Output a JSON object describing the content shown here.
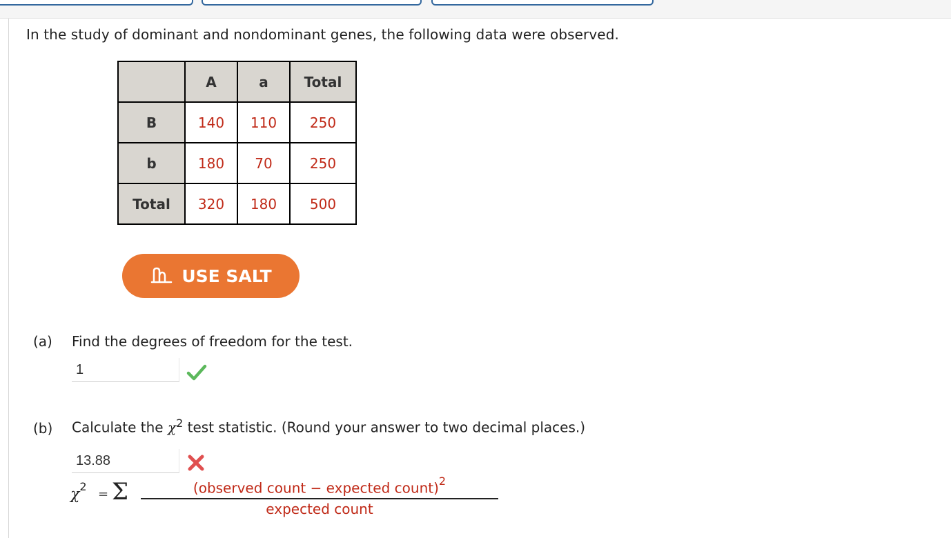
{
  "intro": "In the study of dominant and nondominant genes, the following data were observed.",
  "table": {
    "header": [
      "",
      "A",
      "a",
      "Total"
    ],
    "rows": [
      {
        "label": "B",
        "values": [
          "140",
          "110",
          "250"
        ]
      },
      {
        "label": "b",
        "values": [
          "180",
          "70",
          "250"
        ]
      },
      {
        "label": "Total",
        "values": [
          "320",
          "180",
          "500"
        ]
      }
    ]
  },
  "salt_button": {
    "label": "USE SALT"
  },
  "part_a": {
    "label": "(a)",
    "question": "Find the degrees of freedom for the test.",
    "answer": "1",
    "status": "correct"
  },
  "part_b": {
    "label": "(b)",
    "question_pre": "Calculate the",
    "chi_symbol": "χ",
    "exponent": "2",
    "question_post": "test statistic. (Round your answer to two decimal places.)",
    "answer": "13.88",
    "status": "incorrect"
  },
  "formula": {
    "lhs": "χ",
    "exponent": "2",
    "equals": "=",
    "sigma": "Σ",
    "numerator": "(observed count − expected count)",
    "numerator_exp": "2",
    "denominator": "expected count"
  },
  "colors": {
    "accent_orange": "#ea7632",
    "value_red": "#c02a18",
    "check_green": "#5cb85c",
    "cross_red": "#e05050",
    "tab_blue": "#34689e"
  },
  "icons": {
    "salt": "salt-logo-icon",
    "correct": "checkmark-icon",
    "incorrect": "x-mark-icon"
  }
}
